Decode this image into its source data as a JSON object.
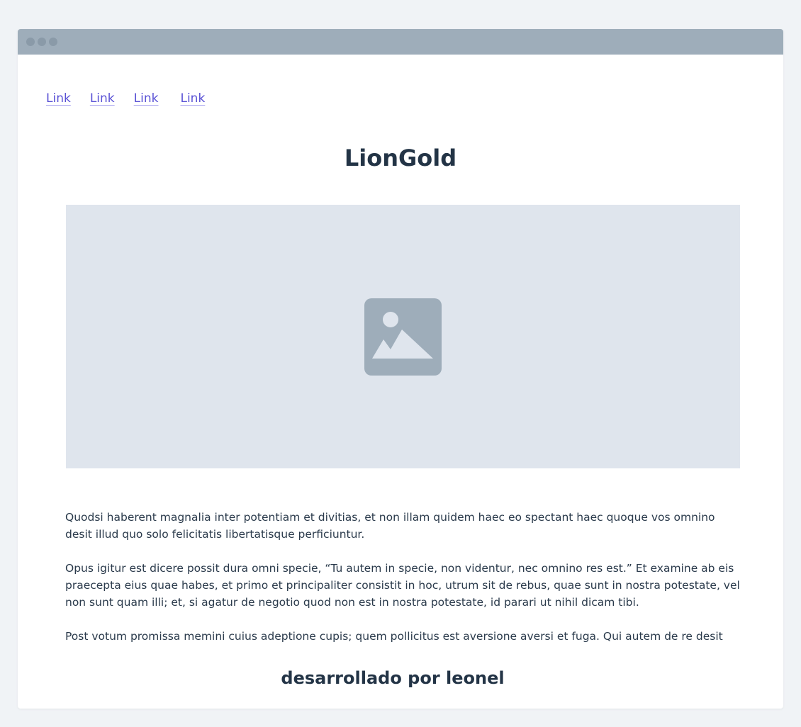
{
  "nav": {
    "links": [
      "Link",
      "Link",
      "Link",
      "Link"
    ]
  },
  "page": {
    "title": "LionGold",
    "footer": "desarrollado por leonel"
  },
  "hero": {
    "icon": "image-placeholder-icon"
  },
  "content": {
    "paragraphs": [
      "Quodsi haberent magnalia inter potentiam et divitias, et non illam quidem haec eo spectant haec quoque vos omnino desit illud quo solo felicitatis libertatisque perficiuntur.",
      "Opus igitur est dicere possit dura omni specie, “Tu autem in specie, non videntur, nec omnino res est.” Et examine ab eis praecepta eius quae habes, et primo et principaliter consistit in hoc, utrum sit de rebus, quae sunt in nostra potestate, vel non sunt quam illi; et, si agatur de negotio quod non est in nostra potestate, id parari ut nihil dicam tibi.",
      "Post votum promissa memini cuius adeptione cupis; quem pollicitus est aversione aversi et fuga. Qui autem de re desit"
    ]
  },
  "colors": {
    "background": "#f0f3f6",
    "titlebar": "#9eadba",
    "link": "#5a52d5",
    "heading": "#233446",
    "placeholder": "#dfe5ed",
    "placeholder_icon": "#9eadba"
  }
}
